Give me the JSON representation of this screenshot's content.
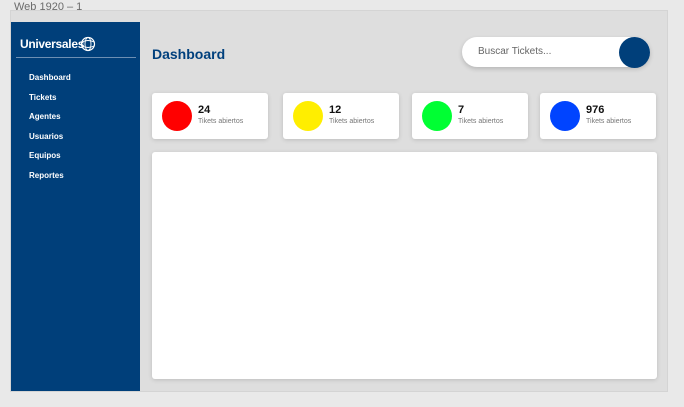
{
  "artboard": {
    "label": "Web 1920 – 1"
  },
  "sidebar": {
    "logo_text": "Universales",
    "items": [
      {
        "label": "Dashboard"
      },
      {
        "label": "Tickets"
      },
      {
        "label": "Agentes"
      },
      {
        "label": "Usuarios"
      },
      {
        "label": "Equipos"
      },
      {
        "label": "Reportes"
      }
    ]
  },
  "header": {
    "title": "Dashboard",
    "search_placeholder": "Buscar Tickets..."
  },
  "stats": [
    {
      "value": "24",
      "caption": "Tikets abiertos",
      "color": "#ff0000"
    },
    {
      "value": "12",
      "caption": "Tikets abiertos",
      "color": "#ffee00"
    },
    {
      "value": "7",
      "caption": "Tikets abiertos",
      "color": "#00ff33"
    },
    {
      "value": "976",
      "caption": "Tikets abiertos",
      "color": "#0044ff"
    }
  ],
  "colors": {
    "brand": "#003f7a",
    "background": "#dedede"
  }
}
